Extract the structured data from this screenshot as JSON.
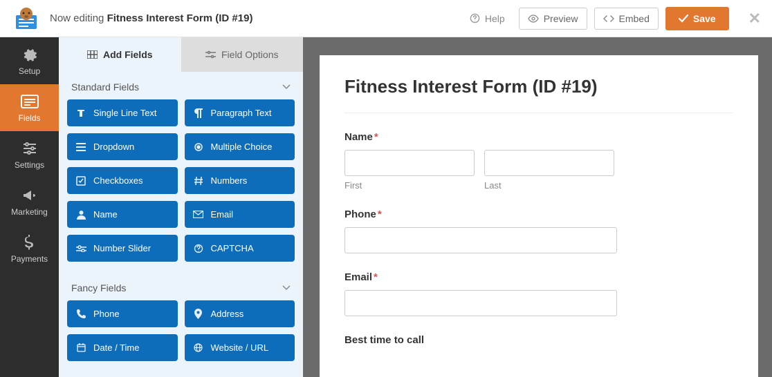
{
  "topbar": {
    "prefix": "Now editing",
    "title": "Fitness Interest Form (ID #19)",
    "help": "Help",
    "preview": "Preview",
    "embed": "Embed",
    "save": "Save"
  },
  "leftnav": [
    {
      "key": "setup",
      "label": "Setup"
    },
    {
      "key": "fields",
      "label": "Fields"
    },
    {
      "key": "settings",
      "label": "Settings"
    },
    {
      "key": "marketing",
      "label": "Marketing"
    },
    {
      "key": "payments",
      "label": "Payments"
    }
  ],
  "tabs": {
    "add_fields": "Add Fields",
    "field_options": "Field Options"
  },
  "sections": {
    "standard": {
      "title": "Standard Fields",
      "fields": [
        {
          "icon": "text",
          "label": "Single Line Text"
        },
        {
          "icon": "paragraph",
          "label": "Paragraph Text"
        },
        {
          "icon": "dropdown",
          "label": "Dropdown"
        },
        {
          "icon": "choice",
          "label": "Multiple Choice"
        },
        {
          "icon": "check",
          "label": "Checkboxes"
        },
        {
          "icon": "hash",
          "label": "Numbers"
        },
        {
          "icon": "user",
          "label": "Name"
        },
        {
          "icon": "email",
          "label": "Email"
        },
        {
          "icon": "slider",
          "label": "Number Slider"
        },
        {
          "icon": "captcha",
          "label": "CAPTCHA"
        }
      ]
    },
    "fancy": {
      "title": "Fancy Fields",
      "fields": [
        {
          "icon": "phone",
          "label": "Phone"
        },
        {
          "icon": "pin",
          "label": "Address"
        },
        {
          "icon": "calendar",
          "label": "Date / Time"
        },
        {
          "icon": "globe",
          "label": "Website / URL"
        }
      ]
    }
  },
  "form": {
    "title": "Fitness Interest Form (ID #19)",
    "name_label": "Name",
    "first": "First",
    "last": "Last",
    "phone_label": "Phone",
    "email_label": "Email",
    "best_time": "Best time to call"
  }
}
